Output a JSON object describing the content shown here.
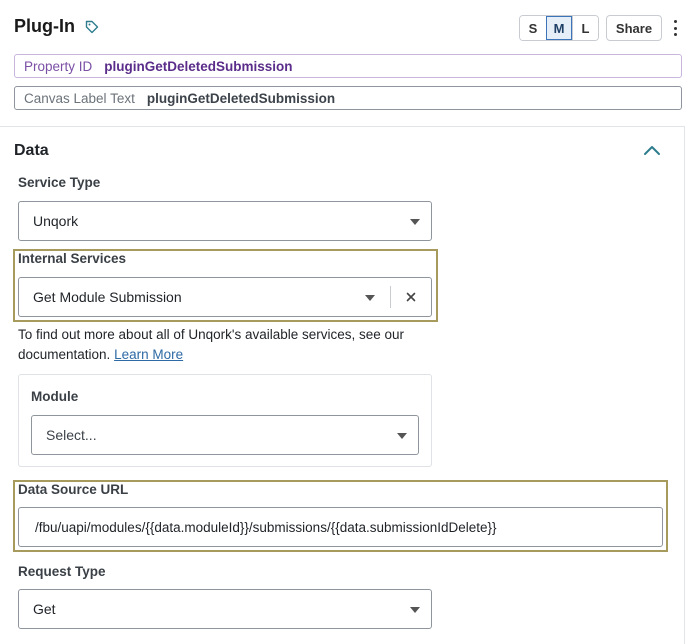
{
  "header": {
    "title": "Plug-In",
    "size_buttons": [
      "S",
      "M",
      "L"
    ],
    "active_size": "M",
    "share_label": "Share"
  },
  "property_id": {
    "label": "Property ID",
    "value": "pluginGetDeletedSubmission"
  },
  "canvas_label": {
    "label": "Canvas Label Text",
    "value": "pluginGetDeletedSubmission"
  },
  "section": {
    "title": "Data"
  },
  "service_type": {
    "label": "Service Type",
    "value": "Unqork"
  },
  "internal_services": {
    "label": "Internal Services",
    "value": "Get Module Submission"
  },
  "help": {
    "text": "To find out more about all of Unqork's available services, see our documentation.",
    "link": "Learn More"
  },
  "module": {
    "label": "Module",
    "placeholder": "Select..."
  },
  "data_source_url": {
    "label": "Data Source URL",
    "value": "/fbu/uapi/modules/{{data.moduleId}}/submissions/{{data.submissionIdDelete}}"
  },
  "request_type": {
    "label": "Request Type",
    "value": "Get"
  },
  "colors": {
    "highlight": "#a69a5c",
    "property_id_purple": "#5b2d8a",
    "link": "#2e6aa5",
    "active_size_border": "#3b74b8",
    "chevron": "#2e7d8c"
  },
  "icons": {
    "title_tag": "tag-icon",
    "menu": "kebab-menu-icon",
    "collapse": "chevron-up-icon",
    "dropdown": "caret-down-icon",
    "clear": "close-icon"
  }
}
